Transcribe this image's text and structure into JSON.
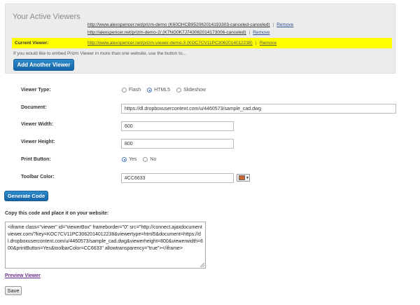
{
  "panel": {
    "title": "Your Active Viewers",
    "viewers": [
      {
        "url": "http://www.alexspencer.net/prizm-demo (K60OHCB952062014193303-canceled-canceled)",
        "remove": "Remove"
      },
      {
        "url": "http://alexspencer.net/prizm-demo-2/ (K7NG0K7J743062014173006-canceled)",
        "remove": "Remove"
      }
    ],
    "current": {
      "label": "Current Viewer:",
      "url": "http://www.alexspencer.net/prizm-viewer-demo-3 (KOC7CV11PC3062014012238)",
      "remove": "Remove"
    },
    "embed_note": "If you would like to embed Prizm Viewer in more than one website, use the button to...",
    "add_button": "Add Another Viewer"
  },
  "form": {
    "viewer_type": {
      "label": "Viewer Type:",
      "options": [
        "Flash",
        "HTML5",
        "Slideshow"
      ],
      "selected": "HTML5"
    },
    "document": {
      "label": "Document:",
      "value": "https://dl.dropboxusercontent.com/u/4460573/sample_cad.dwg"
    },
    "viewer_width": {
      "label": "Viewer Width:",
      "value": "600"
    },
    "viewer_height": {
      "label": "Viewer Height:",
      "value": "800"
    },
    "print_button": {
      "label": "Print Button:",
      "options": [
        "Yes",
        "No"
      ],
      "selected": "Yes"
    },
    "toolbar_color": {
      "label": "Toolbar Color:",
      "value": "#CC6633",
      "swatch": "#CC6633"
    }
  },
  "generate_button": "Generate Code",
  "copy_label": "Copy this code and place it on your website:",
  "code": "<iframe class=\"viewer\" id=\"viewerBox\" frameborder=\"0\" src=\"http://connect.ajaxdocumentviewer.com/?key=KOC7CV11PC3062014012238&viewertype=html5&document=https://dl.dropboxusercontent.com/u/4460573/sample_cad.dwg&viewerheight=800&viewerwidth=600&printButton=Yes&toolbarColor=CC6633\" allowtransparency=\"true\"></iframe>",
  "preview_link": "Preview Viewer",
  "save_button": "Save"
}
